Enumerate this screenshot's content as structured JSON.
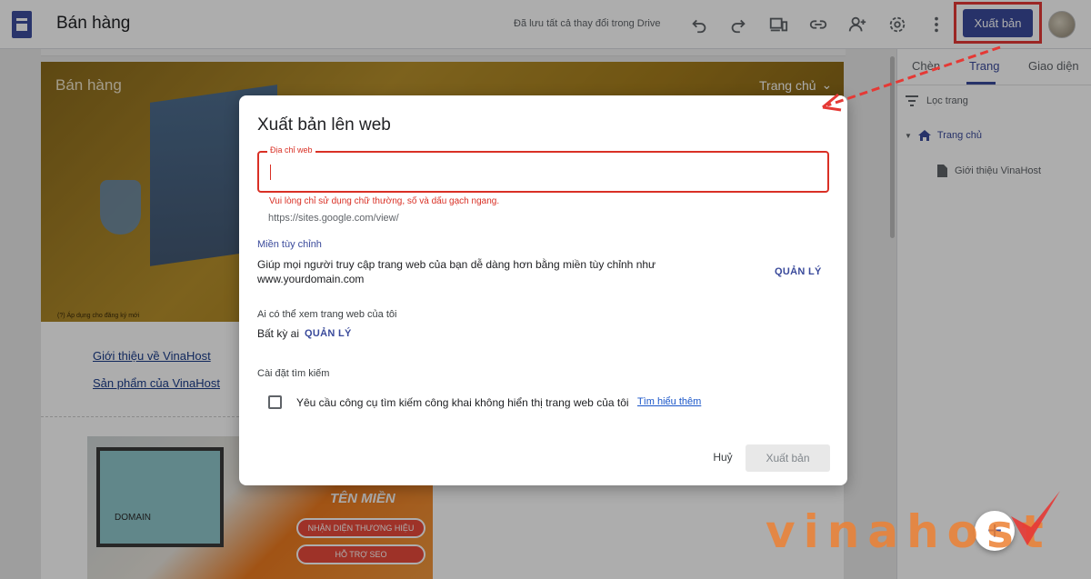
{
  "app": {
    "title": "Bán hàng",
    "save_status": "Đã lưu tất cả thay đổi trong Drive",
    "publish_label": "Xuất bản"
  },
  "toolbar_icons": [
    "undo-icon",
    "redo-icon",
    "preview-device-icon",
    "link-icon",
    "share-icon",
    "settings-icon",
    "more-vert-icon"
  ],
  "site_preview": {
    "hero_title": "Bán hàng",
    "nav_label": "Trang chủ",
    "image_caption": "(?) Áp dụng cho đăng ký mới",
    "links": [
      "Giới thiệu về VinaHost",
      "Sản phẩm của VinaHost"
    ],
    "banner_domain": "DOMAIN",
    "banner_title": "TÊN MIỀN",
    "banner_pills": [
      "NHẬN DIỆN THƯƠNG HIỆU",
      "HỖ TRỢ SEO"
    ]
  },
  "right_panel": {
    "tabs": [
      "Chèn",
      "Trang",
      "Giao diện"
    ],
    "active_tab": "Trang",
    "filter_label": "Lọc trang",
    "pages": {
      "home": "Trang chủ",
      "child": "Giới thiệu VinaHost"
    }
  },
  "dialog": {
    "title": "Xuất bản lên web",
    "field_label": "Địa chỉ web",
    "field_value": "",
    "error": "Vui lòng chỉ sử dụng chữ thường, số và dấu gạch ngang.",
    "url_prefix": "https://sites.google.com/view/",
    "custom_domain": {
      "heading": "Miền tùy chỉnh",
      "description": "Giúp mọi người truy cập trang web của bạn dễ dàng hơn bằng miền tùy chỉnh như www.yourdomain.com",
      "manage": "QUẢN LÝ"
    },
    "viewers": {
      "heading": "Ai có thể xem trang web của tôi",
      "value": "Bất kỳ ai",
      "manage": "QUẢN LÝ"
    },
    "search": {
      "heading": "Cài đặt tìm kiếm",
      "checkbox_label": "Yêu cầu công cụ tìm kiếm công khai không hiển thị trang web của tôi",
      "checkbox_checked": false,
      "learn_more": "Tìm hiểu thêm"
    },
    "cancel_label": "Huỷ",
    "publish_label": "Xuất bản"
  },
  "watermark": "vinahost",
  "colors": {
    "accent": "#3a4a9b",
    "error": "#d93025",
    "annotation": "#e53935"
  }
}
